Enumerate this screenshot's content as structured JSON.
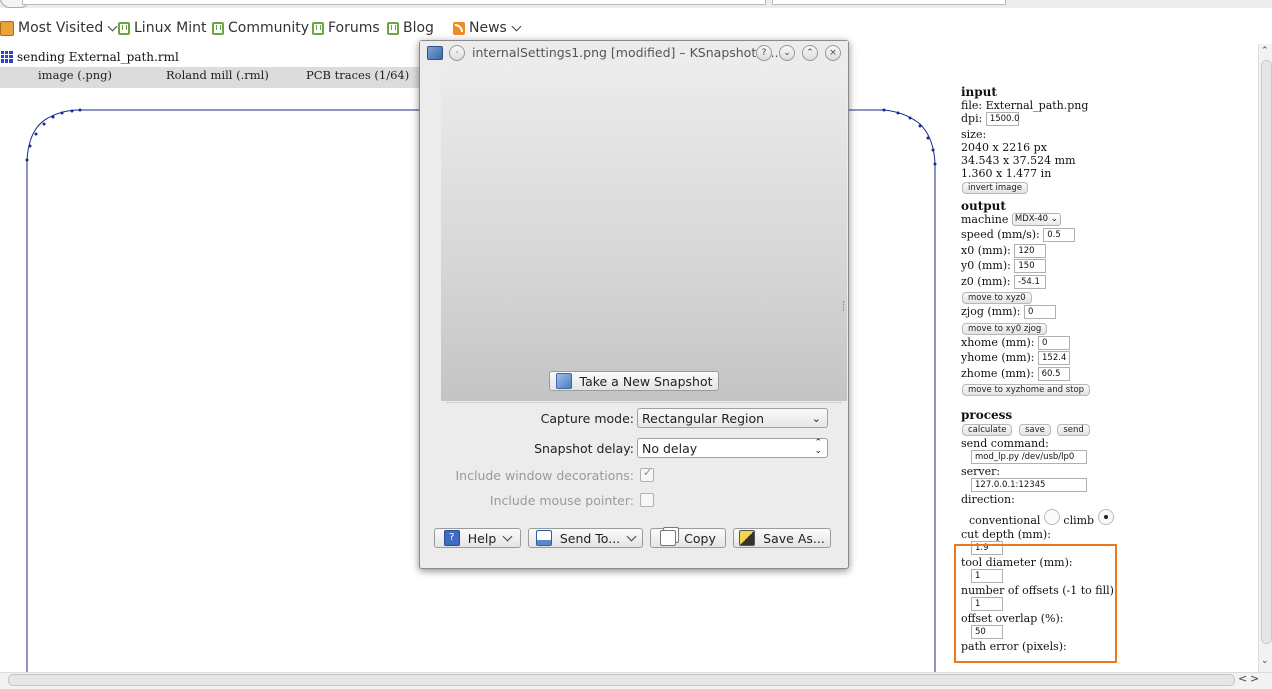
{
  "browser": {
    "bookmarks": [
      {
        "label": "Most Visited",
        "icon": "folder-icon",
        "has_menu": true
      },
      {
        "label": "Linux Mint",
        "icon": "mint-icon",
        "has_menu": false
      },
      {
        "label": "Community",
        "icon": "mint-icon",
        "has_menu": false
      },
      {
        "label": "Forums",
        "icon": "mint-icon",
        "has_menu": false
      },
      {
        "label": "Blog",
        "icon": "mint-icon",
        "has_menu": false
      },
      {
        "label": "News",
        "icon": "rss-icon",
        "has_menu": true
      }
    ]
  },
  "page": {
    "title": "sending External_path.rml",
    "workflow": [
      "image (.png)",
      "Roland mill (.rml)",
      "PCB traces (1/64)"
    ]
  },
  "panel": {
    "input": {
      "heading": "input",
      "file": "file: External_path.png",
      "dpi_label": "dpi:",
      "dpi_value": "1500.0",
      "size_label": "size:",
      "size_px": "2040 x 2216 px",
      "size_mm": "34.543 x 37.524 mm",
      "size_in": "1.360 x 1.477 in",
      "invert_button": "invert image"
    },
    "output": {
      "heading": "output",
      "machine_label": "machine",
      "machine_value": "MDX-40",
      "speed_label": "speed (mm/s):",
      "speed_value": "0.5",
      "x0_label": "x0 (mm):",
      "x0_value": "120",
      "y0_label": "y0 (mm):",
      "y0_value": "150",
      "z0_label": "z0 (mm):",
      "z0_value": "-54.1",
      "move_xyz0_button": "move to xyz0",
      "zjog_label": "zjog (mm):",
      "zjog_value": "0",
      "move_xy0_button": "move to xy0 zjog",
      "xhome_label": "xhome (mm):",
      "xhome_value": "0",
      "yhome_label": "yhome (mm):",
      "yhome_value": "152.4",
      "zhome_label": "zhome (mm):",
      "zhome_value": "60.5",
      "move_home_button": "move to xyzhome and stop"
    },
    "process": {
      "heading": "process",
      "calculate_button": "calculate",
      "save_button": "save",
      "send_button": "send",
      "send_command_label": "send command:",
      "send_command_value": "mod_lp.py /dev/usb/lp0",
      "server_label": "server:",
      "server_value": "127.0.0.1:12345",
      "direction_label": "direction:",
      "conventional_label": "conventional",
      "climb_label": "climb",
      "direction_selected": "climb",
      "cut_depth_label": "cut depth (mm):",
      "cut_depth_value": "1.9",
      "tool_diameter_label": "tool diameter (mm):",
      "tool_diameter_value": "1",
      "offsets_label": "number of offsets (-1 to fill):",
      "offsets_value": "1",
      "overlap_label": "offset overlap (%):",
      "overlap_value": "50",
      "path_error_label": "path error (pixels):"
    },
    "highlight_color": "#ec7a1b"
  },
  "dialog": {
    "title": "internalSettings1.png [modified] – KSnapshot <...",
    "new_snapshot_button": "Take a New Snapshot",
    "capture_mode_label": "Capture mode:",
    "capture_mode_value": "Rectangular Region",
    "snapshot_delay_label": "Snapshot delay:",
    "snapshot_delay_value": "No delay",
    "include_decorations_label": "Include window decorations:",
    "include_decorations_checked": true,
    "include_pointer_label": "Include mouse pointer:",
    "include_pointer_checked": false,
    "help_button": "Help",
    "send_to_button": "Send To...",
    "copy_button": "Copy",
    "save_as_button": "Save As..."
  }
}
